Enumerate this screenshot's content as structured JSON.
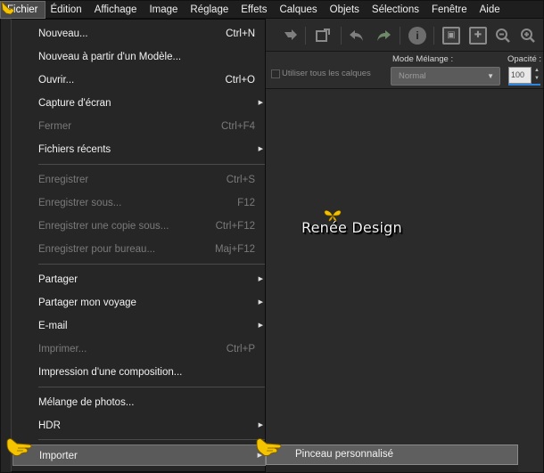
{
  "menubar": {
    "items": [
      {
        "label": "Fichier",
        "active": true
      },
      {
        "label": "Édition",
        "active": false
      },
      {
        "label": "Affichage",
        "active": false
      },
      {
        "label": "Image",
        "active": false
      },
      {
        "label": "Réglage",
        "active": false
      },
      {
        "label": "Effets",
        "active": false
      },
      {
        "label": "Calques",
        "active": false
      },
      {
        "label": "Objets",
        "active": false
      },
      {
        "label": "Sélections",
        "active": false
      },
      {
        "label": "Fenêtre",
        "active": false
      },
      {
        "label": "Aide",
        "active": false
      }
    ]
  },
  "toolbar": {
    "icons": [
      "flip-icon",
      "crop-icon",
      "undo-icon",
      "redo-icon",
      "info-icon",
      "fit-window-icon",
      "actual-size-icon",
      "zoom-out-icon",
      "zoom-in-icon"
    ]
  },
  "options": {
    "use_all_layers_label": "Utiliser tous les calques",
    "blend_mode_label": "Mode Mélange :",
    "blend_mode_value": "Normal",
    "opacity_label": "Opacité :",
    "opacity_value": "100"
  },
  "fichier_menu": {
    "items": [
      {
        "label": "Nouveau...",
        "shortcut": "Ctrl+N",
        "disabled": false,
        "submenu": false
      },
      {
        "label": "Nouveau à partir d'un Modèle...",
        "shortcut": "",
        "disabled": false,
        "submenu": false
      },
      {
        "label": "Ouvrir...",
        "shortcut": "Ctrl+O",
        "disabled": false,
        "submenu": false
      },
      {
        "label": "Capture d'écran",
        "shortcut": "",
        "disabled": false,
        "submenu": true
      },
      {
        "label": "Fermer",
        "shortcut": "Ctrl+F4",
        "disabled": true,
        "submenu": false
      },
      {
        "label": "Fichiers récents",
        "shortcut": "",
        "disabled": false,
        "submenu": true
      },
      {
        "label": "Enregistrer",
        "shortcut": "Ctrl+S",
        "disabled": true,
        "submenu": false
      },
      {
        "label": "Enregistrer sous...",
        "shortcut": "F12",
        "disabled": true,
        "submenu": false
      },
      {
        "label": "Enregistrer une copie sous...",
        "shortcut": "Ctrl+F12",
        "disabled": true,
        "submenu": false
      },
      {
        "label": "Enregistrer pour bureau...",
        "shortcut": "Maj+F12",
        "disabled": true,
        "submenu": false
      },
      {
        "label": "Partager",
        "shortcut": "",
        "disabled": false,
        "submenu": true
      },
      {
        "label": "Partager mon voyage",
        "shortcut": "",
        "disabled": false,
        "submenu": true
      },
      {
        "label": "E-mail",
        "shortcut": "",
        "disabled": false,
        "submenu": true
      },
      {
        "label": "Imprimer...",
        "shortcut": "Ctrl+P",
        "disabled": true,
        "submenu": false
      },
      {
        "label": "Impression d'une composition...",
        "shortcut": "",
        "disabled": false,
        "submenu": false
      },
      {
        "label": "Mélange de photos...",
        "shortcut": "",
        "disabled": false,
        "submenu": false
      },
      {
        "label": "HDR",
        "shortcut": "",
        "disabled": false,
        "submenu": true
      },
      {
        "label": "Importer",
        "shortcut": "",
        "disabled": false,
        "submenu": true,
        "highlighted": true
      }
    ]
  },
  "importer_submenu": {
    "items": [
      {
        "label": "Pinceau personnalisé",
        "highlighted": true
      }
    ]
  },
  "watermark": {
    "text": "Renée Design"
  },
  "colors": {
    "menu_bg": "#262626",
    "highlight_bg": "#5a5a5a",
    "disabled_text": "#7a7a7a",
    "accent_blue": "#2e86e0",
    "butterfly_yellow": "#f2c200"
  }
}
